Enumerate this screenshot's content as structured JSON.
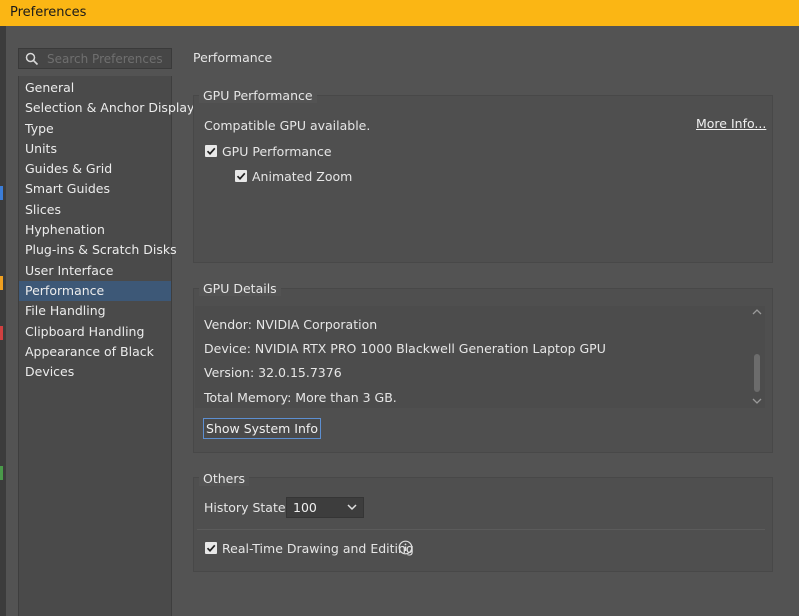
{
  "window": {
    "title": "Preferences"
  },
  "search": {
    "placeholder": "Search Preferences"
  },
  "sidebar": {
    "items": [
      {
        "label": "General"
      },
      {
        "label": "Selection & Anchor Display"
      },
      {
        "label": "Type"
      },
      {
        "label": "Units"
      },
      {
        "label": "Guides & Grid"
      },
      {
        "label": "Smart Guides"
      },
      {
        "label": "Slices"
      },
      {
        "label": "Hyphenation"
      },
      {
        "label": "Plug-ins & Scratch Disks"
      },
      {
        "label": "User Interface"
      },
      {
        "label": "Performance"
      },
      {
        "label": "File Handling"
      },
      {
        "label": "Clipboard Handling"
      },
      {
        "label": "Appearance of Black"
      },
      {
        "label": "Devices"
      }
    ],
    "active": "Performance"
  },
  "page": {
    "title": "Performance",
    "gpu_performance": {
      "group_label": "GPU Performance",
      "status": "Compatible GPU available.",
      "more_info": "More Info...",
      "gpu_checkbox_label": "GPU Performance",
      "gpu_checked": true,
      "animated_zoom_label": "Animated Zoom",
      "animated_zoom_checked": true
    },
    "gpu_details": {
      "group_label": "GPU Details",
      "vendor": "Vendor: NVIDIA Corporation",
      "device": "Device: NVIDIA RTX PRO 1000 Blackwell Generation Laptop GPU",
      "version": "Version: 32.0.15.7376",
      "memory": "Total Memory:  More than 3 GB.",
      "button": "Show System Info"
    },
    "others": {
      "group_label": "Others",
      "history_label": "History States:",
      "history_value": "100",
      "realtime_label": "Real-Time Drawing and Editing",
      "realtime_checked": true
    }
  },
  "colors": {
    "titlebar": "#fbb614",
    "background": "#535353",
    "selection": "#3d5877",
    "button_border": "#5d8fd1"
  }
}
